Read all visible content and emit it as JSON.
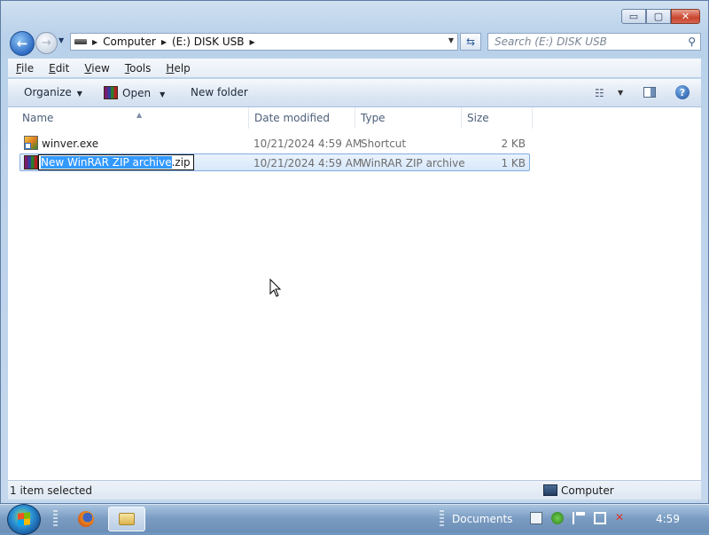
{
  "window": {
    "caption": {
      "minimize": "▭",
      "maximize": "▢",
      "close": "✕"
    }
  },
  "nav": {
    "back_icon": "back-arrow-icon",
    "forward_icon": "forward-arrow-icon",
    "breadcrumb": [
      "Computer",
      "(E:) DISK USB"
    ],
    "search_placeholder": "Search (E:) DISK USB"
  },
  "menubar": {
    "items": [
      {
        "label": "File",
        "underline": "F",
        "rest": "ile"
      },
      {
        "label": "Edit",
        "underline": "E",
        "rest": "dit"
      },
      {
        "label": "View",
        "underline": "V",
        "rest": "iew"
      },
      {
        "label": "Tools",
        "underline": "T",
        "rest": "ools"
      },
      {
        "label": "Help",
        "underline": "H",
        "rest": "elp"
      }
    ]
  },
  "commandbar": {
    "organize": "Organize",
    "open": "Open",
    "new_folder": "New folder"
  },
  "columns": {
    "name": "Name",
    "date_modified": "Date modified",
    "type": "Type",
    "size": "Size"
  },
  "files": [
    {
      "name": "winver.exe",
      "date": "10/21/2024 4:59 AM",
      "type": "Shortcut",
      "size": "2 KB",
      "icon": "shortcut-exe-icon"
    },
    {
      "name_selected": "New WinRAR ZIP archive",
      "name_ext": ".zip",
      "date": "10/21/2024 4:59 AM",
      "type": "WinRAR ZIP archive",
      "size": "1 KB",
      "icon": "winrar-zip-icon"
    }
  ],
  "status": {
    "selection": "1 item selected",
    "location": "Computer"
  },
  "taskbar": {
    "documents_label": "Documents",
    "clock": "4:59"
  },
  "colors": {
    "accent": "#3399ff",
    "taskbar": "#7a9cc2"
  }
}
